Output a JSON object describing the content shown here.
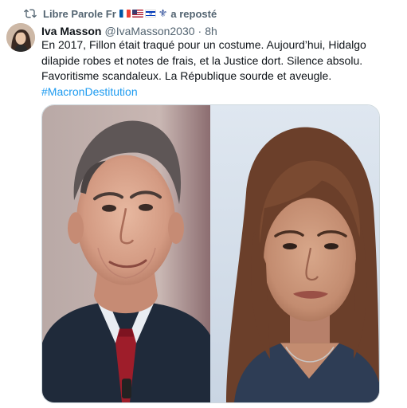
{
  "repost": {
    "account_name": "Libre Parole Fr",
    "label": "a reposté",
    "icon": "repost-icon",
    "flags": [
      "flag-france",
      "flag-usa",
      "flag-israel",
      "fleur-de-lis"
    ]
  },
  "author": {
    "display_name": "Iva Masson",
    "handle": "@IvaMasson2030",
    "separator": "·",
    "timestamp": "8h"
  },
  "tweet": {
    "text": "En 2017, Fillon était traqué pour un costume. Aujourd’hui, Hidalgo dilapide robes et notes de frais, et la Justice dort. Silence absolu. Favoritisme scandaleux. La République sourde et aveugle.",
    "hashtag": "#MacronDestitution"
  },
  "media": {
    "photos": [
      "photo-man-suit-red-tie",
      "photo-woman-brown-hair"
    ]
  },
  "colors": {
    "text_primary": "#0f1419",
    "text_secondary": "#536471",
    "link": "#1d9bf0",
    "border": "#cfd9de"
  }
}
